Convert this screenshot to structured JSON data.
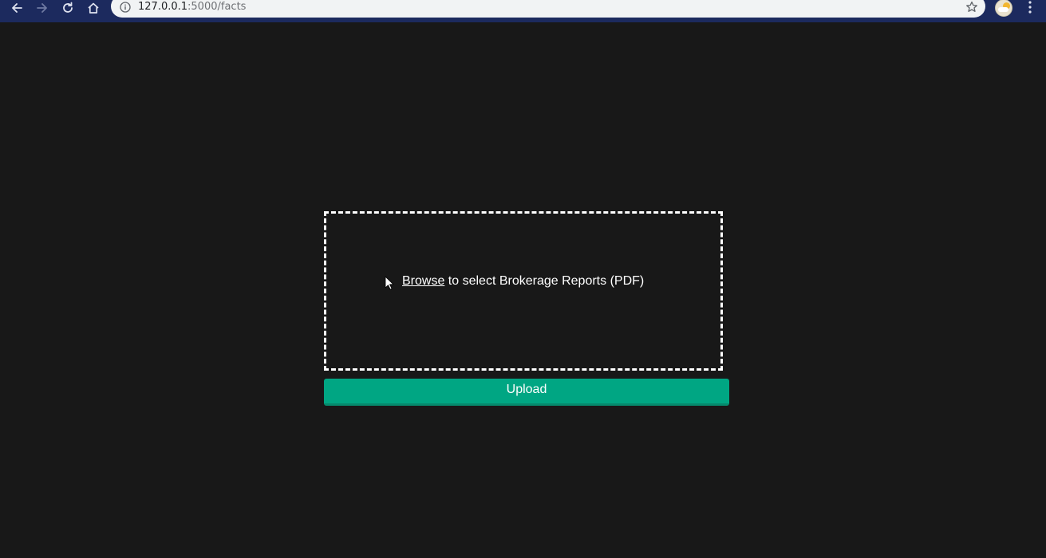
{
  "browser": {
    "url_host": "127.0.0.1",
    "url_path": ":5000/facts"
  },
  "dropzone": {
    "browse_label": "Browse",
    "instruction_text": " to select Brokerage Reports (PDF)"
  },
  "upload_button": {
    "label": "Upload"
  },
  "colors": {
    "page_background": "#181818",
    "browser_bar": "#1c2a5e",
    "upload_button": "#00a683"
  }
}
